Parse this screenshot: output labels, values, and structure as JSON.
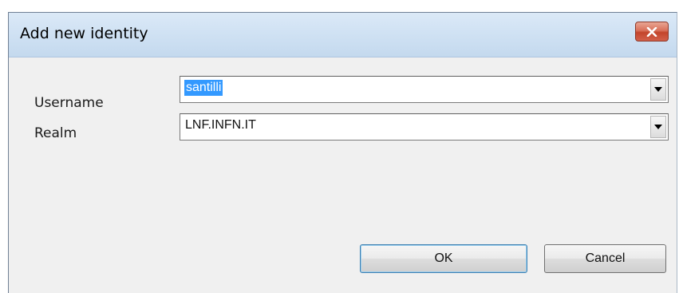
{
  "window": {
    "title": "Add new identity",
    "close_icon": "close-icon"
  },
  "form": {
    "username_label": "Username",
    "username_value": "santilli",
    "realm_label": "Realm",
    "realm_value": "LNF.INFN.IT",
    "dropdown_icon": "chevron-down-icon"
  },
  "buttons": {
    "ok_label": "OK",
    "cancel_label": "Cancel"
  },
  "colors": {
    "selection": "#3399ff",
    "close_button": "#c3452c",
    "titlebar": "#cfe1f3"
  }
}
